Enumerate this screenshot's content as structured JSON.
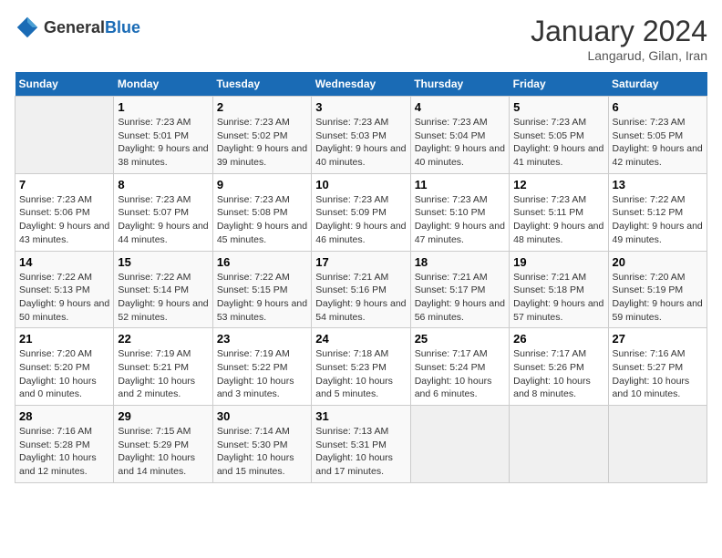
{
  "header": {
    "logo_general": "General",
    "logo_blue": "Blue",
    "title": "January 2024",
    "subtitle": "Langarud, Gilan, Iran"
  },
  "weekdays": [
    "Sunday",
    "Monday",
    "Tuesday",
    "Wednesday",
    "Thursday",
    "Friday",
    "Saturday"
  ],
  "weeks": [
    [
      {
        "day": "",
        "sunrise": "",
        "sunset": "",
        "daylight": ""
      },
      {
        "day": "1",
        "sunrise": "Sunrise: 7:23 AM",
        "sunset": "Sunset: 5:01 PM",
        "daylight": "Daylight: 9 hours and 38 minutes."
      },
      {
        "day": "2",
        "sunrise": "Sunrise: 7:23 AM",
        "sunset": "Sunset: 5:02 PM",
        "daylight": "Daylight: 9 hours and 39 minutes."
      },
      {
        "day": "3",
        "sunrise": "Sunrise: 7:23 AM",
        "sunset": "Sunset: 5:03 PM",
        "daylight": "Daylight: 9 hours and 40 minutes."
      },
      {
        "day": "4",
        "sunrise": "Sunrise: 7:23 AM",
        "sunset": "Sunset: 5:04 PM",
        "daylight": "Daylight: 9 hours and 40 minutes."
      },
      {
        "day": "5",
        "sunrise": "Sunrise: 7:23 AM",
        "sunset": "Sunset: 5:05 PM",
        "daylight": "Daylight: 9 hours and 41 minutes."
      },
      {
        "day": "6",
        "sunrise": "Sunrise: 7:23 AM",
        "sunset": "Sunset: 5:05 PM",
        "daylight": "Daylight: 9 hours and 42 minutes."
      }
    ],
    [
      {
        "day": "7",
        "sunrise": "Sunrise: 7:23 AM",
        "sunset": "Sunset: 5:06 PM",
        "daylight": "Daylight: 9 hours and 43 minutes."
      },
      {
        "day": "8",
        "sunrise": "Sunrise: 7:23 AM",
        "sunset": "Sunset: 5:07 PM",
        "daylight": "Daylight: 9 hours and 44 minutes."
      },
      {
        "day": "9",
        "sunrise": "Sunrise: 7:23 AM",
        "sunset": "Sunset: 5:08 PM",
        "daylight": "Daylight: 9 hours and 45 minutes."
      },
      {
        "day": "10",
        "sunrise": "Sunrise: 7:23 AM",
        "sunset": "Sunset: 5:09 PM",
        "daylight": "Daylight: 9 hours and 46 minutes."
      },
      {
        "day": "11",
        "sunrise": "Sunrise: 7:23 AM",
        "sunset": "Sunset: 5:10 PM",
        "daylight": "Daylight: 9 hours and 47 minutes."
      },
      {
        "day": "12",
        "sunrise": "Sunrise: 7:23 AM",
        "sunset": "Sunset: 5:11 PM",
        "daylight": "Daylight: 9 hours and 48 minutes."
      },
      {
        "day": "13",
        "sunrise": "Sunrise: 7:22 AM",
        "sunset": "Sunset: 5:12 PM",
        "daylight": "Daylight: 9 hours and 49 minutes."
      }
    ],
    [
      {
        "day": "14",
        "sunrise": "Sunrise: 7:22 AM",
        "sunset": "Sunset: 5:13 PM",
        "daylight": "Daylight: 9 hours and 50 minutes."
      },
      {
        "day": "15",
        "sunrise": "Sunrise: 7:22 AM",
        "sunset": "Sunset: 5:14 PM",
        "daylight": "Daylight: 9 hours and 52 minutes."
      },
      {
        "day": "16",
        "sunrise": "Sunrise: 7:22 AM",
        "sunset": "Sunset: 5:15 PM",
        "daylight": "Daylight: 9 hours and 53 minutes."
      },
      {
        "day": "17",
        "sunrise": "Sunrise: 7:21 AM",
        "sunset": "Sunset: 5:16 PM",
        "daylight": "Daylight: 9 hours and 54 minutes."
      },
      {
        "day": "18",
        "sunrise": "Sunrise: 7:21 AM",
        "sunset": "Sunset: 5:17 PM",
        "daylight": "Daylight: 9 hours and 56 minutes."
      },
      {
        "day": "19",
        "sunrise": "Sunrise: 7:21 AM",
        "sunset": "Sunset: 5:18 PM",
        "daylight": "Daylight: 9 hours and 57 minutes."
      },
      {
        "day": "20",
        "sunrise": "Sunrise: 7:20 AM",
        "sunset": "Sunset: 5:19 PM",
        "daylight": "Daylight: 9 hours and 59 minutes."
      }
    ],
    [
      {
        "day": "21",
        "sunrise": "Sunrise: 7:20 AM",
        "sunset": "Sunset: 5:20 PM",
        "daylight": "Daylight: 10 hours and 0 minutes."
      },
      {
        "day": "22",
        "sunrise": "Sunrise: 7:19 AM",
        "sunset": "Sunset: 5:21 PM",
        "daylight": "Daylight: 10 hours and 2 minutes."
      },
      {
        "day": "23",
        "sunrise": "Sunrise: 7:19 AM",
        "sunset": "Sunset: 5:22 PM",
        "daylight": "Daylight: 10 hours and 3 minutes."
      },
      {
        "day": "24",
        "sunrise": "Sunrise: 7:18 AM",
        "sunset": "Sunset: 5:23 PM",
        "daylight": "Daylight: 10 hours and 5 minutes."
      },
      {
        "day": "25",
        "sunrise": "Sunrise: 7:17 AM",
        "sunset": "Sunset: 5:24 PM",
        "daylight": "Daylight: 10 hours and 6 minutes."
      },
      {
        "day": "26",
        "sunrise": "Sunrise: 7:17 AM",
        "sunset": "Sunset: 5:26 PM",
        "daylight": "Daylight: 10 hours and 8 minutes."
      },
      {
        "day": "27",
        "sunrise": "Sunrise: 7:16 AM",
        "sunset": "Sunset: 5:27 PM",
        "daylight": "Daylight: 10 hours and 10 minutes."
      }
    ],
    [
      {
        "day": "28",
        "sunrise": "Sunrise: 7:16 AM",
        "sunset": "Sunset: 5:28 PM",
        "daylight": "Daylight: 10 hours and 12 minutes."
      },
      {
        "day": "29",
        "sunrise": "Sunrise: 7:15 AM",
        "sunset": "Sunset: 5:29 PM",
        "daylight": "Daylight: 10 hours and 14 minutes."
      },
      {
        "day": "30",
        "sunrise": "Sunrise: 7:14 AM",
        "sunset": "Sunset: 5:30 PM",
        "daylight": "Daylight: 10 hours and 15 minutes."
      },
      {
        "day": "31",
        "sunrise": "Sunrise: 7:13 AM",
        "sunset": "Sunset: 5:31 PM",
        "daylight": "Daylight: 10 hours and 17 minutes."
      },
      {
        "day": "",
        "sunrise": "",
        "sunset": "",
        "daylight": ""
      },
      {
        "day": "",
        "sunrise": "",
        "sunset": "",
        "daylight": ""
      },
      {
        "day": "",
        "sunrise": "",
        "sunset": "",
        "daylight": ""
      }
    ]
  ]
}
